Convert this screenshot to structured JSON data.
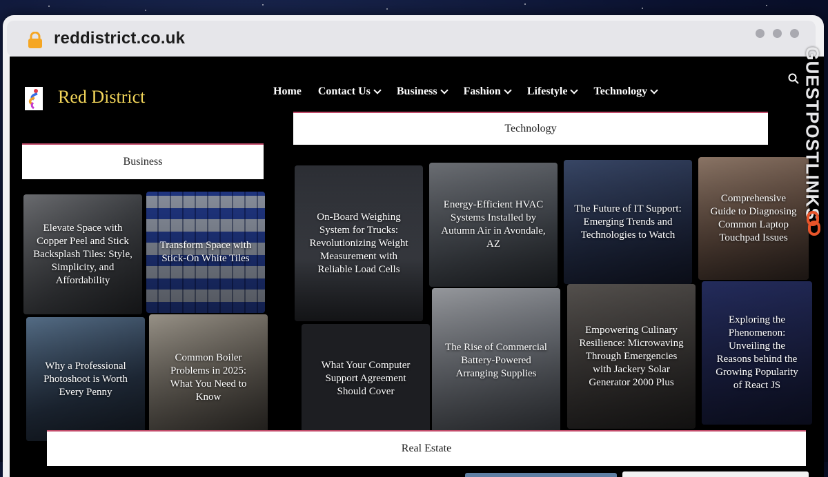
{
  "browser": {
    "url": "reddistrict.co.uk"
  },
  "site": {
    "title": "Red District",
    "nav": [
      {
        "label": "Home",
        "has_dropdown": false
      },
      {
        "label": "Contact Us",
        "has_dropdown": true
      },
      {
        "label": "Business",
        "has_dropdown": true
      },
      {
        "label": "Fashion",
        "has_dropdown": true
      },
      {
        "label": "Lifestyle",
        "has_dropdown": true
      },
      {
        "label": "Technology",
        "has_dropdown": true
      }
    ]
  },
  "sections": {
    "business": {
      "heading": "Business",
      "posts": [
        "Elevate Space with Copper Peel and Stick Backsplash Tiles: Style, Simplicity, and Affordability",
        "Transform Space with Stick-On White Tiles",
        "Why a Professional Photoshoot is Worth Every Penny",
        "Common Boiler Problems in 2025: What You Need to Know"
      ]
    },
    "technology": {
      "heading": "Technology",
      "posts": [
        "On-Board Weighing System for Trucks: Revolutionizing Weight Measurement with Reliable Load Cells",
        "Energy-Efficient HVAC Systems Installed by Autumn Air in Avondale, AZ",
        "The Future of IT Support: Emerging Trends and Technologies to Watch",
        "Comprehensive Guide to Diagnosing Common Laptop Touchpad Issues",
        "What Your Computer Support Agreement Should Cover",
        "The Rise of Commercial Battery-Powered Arranging Supplies",
        "Empowering Culinary Resilience: Microwaving Through Emergencies with Jackery Solar Generator 2000 Plus",
        "Exploring the Phenomenon: Unveiling the Reasons behind the Growing Popularity of React JS"
      ]
    },
    "real_estate": {
      "heading": "Real Estate"
    }
  },
  "watermark": {
    "text": "GUESTPOSTLINKS"
  },
  "colors": {
    "accent": "#c24b6a",
    "site_title": "#f3d65a",
    "site_bg": "#000000",
    "lock": "#f5a623"
  },
  "icons": [
    "lock-icon",
    "search-icon",
    "link-icon",
    "chevron-down-icon"
  ]
}
